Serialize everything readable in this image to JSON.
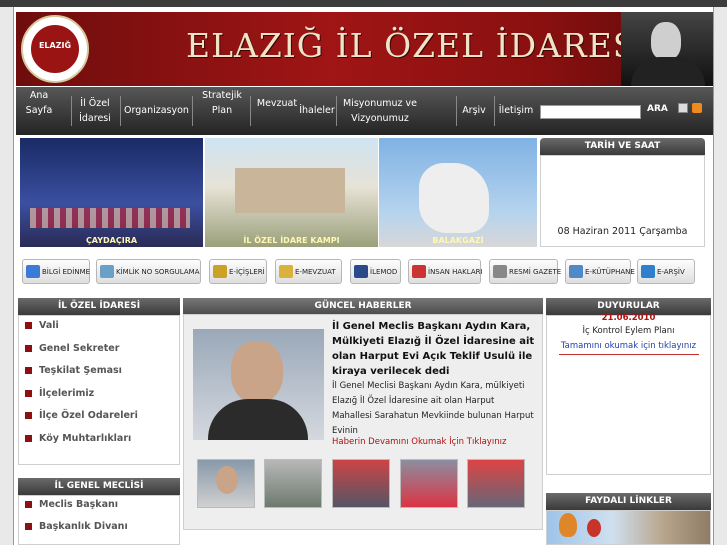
{
  "header": {
    "title": "ELAZIĞ İL ÖZEL İDARESİ",
    "seal_text": "ELAZIĞ",
    "seal_top": "İL ÖZEL İDARESİ"
  },
  "nav": {
    "items": [
      "Ana Sayfa",
      "İl Özel İdaresi",
      "Organizasyon",
      "Stratejik Plan",
      "Mevzuat",
      "İhaleler",
      "Misyonumuz ve Vizyonumuz",
      "Arşiv",
      "İletişim"
    ],
    "search_button": "ARA"
  },
  "photos": [
    {
      "caption": "ÇAYDAÇIRA"
    },
    {
      "caption": "İL ÖZEL İDARE KAMPI"
    },
    {
      "caption": "BALAKGAZİ"
    }
  ],
  "date_panel": {
    "title": "TARİH VE SAAT",
    "date": "08 Haziran 2011 Çarşamba"
  },
  "buttons": [
    "BİLGİ EDİNME",
    "KİMLİK NO SORGULAMA",
    "E-İÇİŞLERİ",
    "E-MEVZUAT",
    "İLEMOD",
    "İNSAN HAKLARI",
    "RESMİ GAZETE",
    "E-KÜTÜPHANE",
    "E-ARŞİV"
  ],
  "left": {
    "title1": "İL ÖZEL İDARESİ",
    "items1": [
      "Vali",
      "Genel Sekreter",
      "Teşkilat Şeması",
      "İlçelerimiz",
      "İlçe Özel Odareleri",
      "Köy Muhtarlıkları"
    ],
    "title2": "İL GENEL MECLİSİ",
    "items2": [
      "Meclis Başkanı",
      "Başkanlık Divanı"
    ]
  },
  "news": {
    "title": "GÜNCEL HABERLER",
    "headline": "İl Genel Meclis Başkanı Aydın Kara, Mülkiyeti Elazığ İl Özel İdaresine ait olan Harput Evi Açık Teklif Usulü ile kiraya verilecek dedi",
    "body": "İl Genel Meclisi Başkanı Aydın Kara, mülkiyeti Elazığ İl Özel İdaresine ait olan Harput Mahallesi Sarahatun Mevkiinde bulunan Harput Evinin",
    "more": "Haberin Devamını Okumak İçin Tıklayınız"
  },
  "announcements": {
    "title": "DUYURULAR",
    "date": "21.06.2010",
    "item": "İç Kontrol Eylem Planı",
    "more": "Tamamını okumak için tıklayınız"
  },
  "links": {
    "title": "FAYDALI LİNKLER"
  },
  "colors": {
    "brand": "#9a1414",
    "link": "#2244aa"
  }
}
